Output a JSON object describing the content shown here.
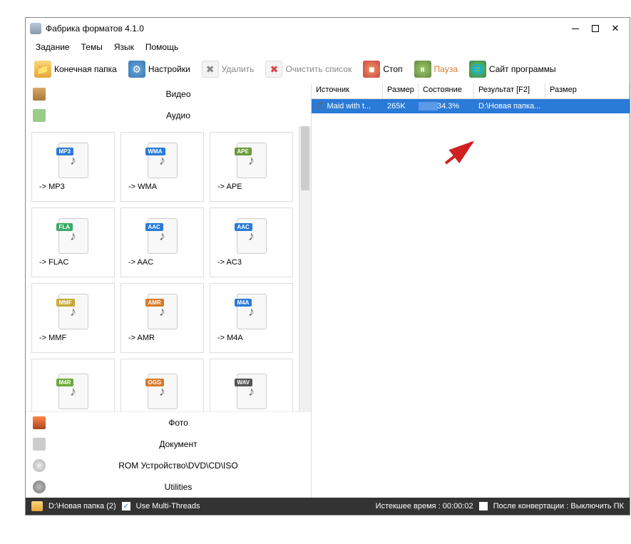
{
  "window": {
    "title": "Фабрика форматов 4.1.0"
  },
  "menu": {
    "task": "Задание",
    "themes": "Темы",
    "lang": "Язык",
    "help": "Помощь"
  },
  "toolbar": {
    "outfolder": "Конечная папка",
    "settings": "Настройки",
    "delete": "Удалить",
    "clear": "Очистить список",
    "stop": "Стоп",
    "pause": "Пауза",
    "site": "Сайт программы"
  },
  "cats": {
    "video": "Видео",
    "audio": "Аудио",
    "photo": "Фото",
    "doc": "Документ",
    "rom": "ROM Устройство\\DVD\\CD\\ISO",
    "util": "Utilities"
  },
  "formats": [
    {
      "tag": "MP3",
      "color": "#2a7ad8",
      "label": "-> MP3"
    },
    {
      "tag": "WMA",
      "color": "#2a7ad8",
      "label": "-> WMA"
    },
    {
      "tag": "APE",
      "color": "#6a9a3a",
      "label": "-> APE"
    },
    {
      "tag": "FLA",
      "color": "#3aaa6a",
      "label": "-> FLAC"
    },
    {
      "tag": "AAC",
      "color": "#2a7ad8",
      "label": "-> AAC"
    },
    {
      "tag": "AAC",
      "color": "#2a7ad8",
      "label": "-> AC3"
    },
    {
      "tag": "MMF",
      "color": "#c8a838",
      "label": "-> MMF"
    },
    {
      "tag": "AMR",
      "color": "#d87a2a",
      "label": "-> AMR"
    },
    {
      "tag": "M4A",
      "color": "#2a7ad8",
      "label": "-> M4A"
    },
    {
      "tag": "M4R",
      "color": "#6aaa3a",
      "label": ""
    },
    {
      "tag": "OGG",
      "color": "#d87a2a",
      "label": ""
    },
    {
      "tag": "WAV",
      "color": "#555555",
      "label": ""
    }
  ],
  "columns": {
    "source": "Источник",
    "size": "Размер",
    "state": "Состояние",
    "result": "Результат [F2]",
    "size2": "Размер"
  },
  "task": {
    "source": "Maid with t...",
    "size": "265K",
    "state": "34.3%",
    "progress": 34.3,
    "result": "D:\\Новая папка..."
  },
  "status": {
    "path": "D:\\Новая папка (2)",
    "multith": "Use Multi-Threads",
    "elapsed": "Истекшее время : 00:00:02",
    "after": "После конвертации : Выключить ПК"
  }
}
